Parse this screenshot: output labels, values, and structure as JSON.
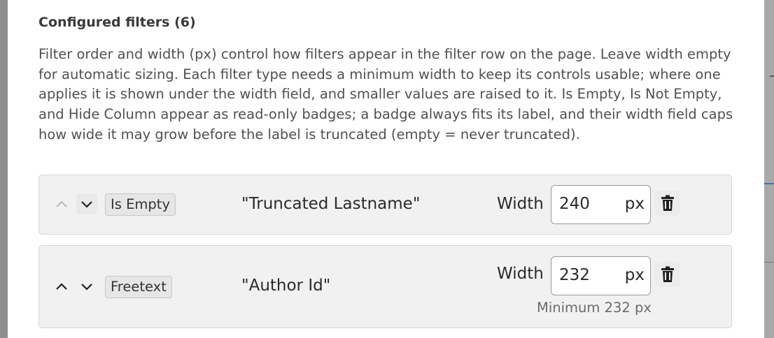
{
  "section": {
    "title": "Configured filters (6)",
    "description": "Filter order and width (px) control how filters appear in the filter row on the page. Leave width empty for automatic sizing. Each filter type needs a minimum width to keep its controls usable; where one applies it is shown under the width field, and smaller values are raised to it. Is Empty, Is Not Empty, and Hide Column appear as read-only badges; a badge always fits its label, and their width field caps how wide it may grow before the label is truncated (empty = never truncated)."
  },
  "filters": [
    {
      "type_badge": "Is Empty",
      "column": "\"Truncated Lastname\"",
      "width_label": "Width",
      "width_value": "240",
      "width_unit": "px",
      "move_up_enabled": false,
      "move_down_enabled": true,
      "min_hint": ""
    },
    {
      "type_badge": "Freetext",
      "column": "\"Author Id\"",
      "width_label": "Width",
      "width_value": "232",
      "width_unit": "px",
      "move_up_enabled": true,
      "move_down_enabled": true,
      "min_hint": "Minimum 232 px"
    }
  ],
  "icons": {
    "move_up": "chevron-up-icon",
    "move_down": "chevron-down-icon",
    "delete": "trash-icon"
  },
  "colors": {
    "card_background": "#f1f1f1",
    "card_border": "#d6d6d6",
    "disabled_arrow": "#b5b5b5",
    "enabled_arrow": "#1f1f1f"
  }
}
